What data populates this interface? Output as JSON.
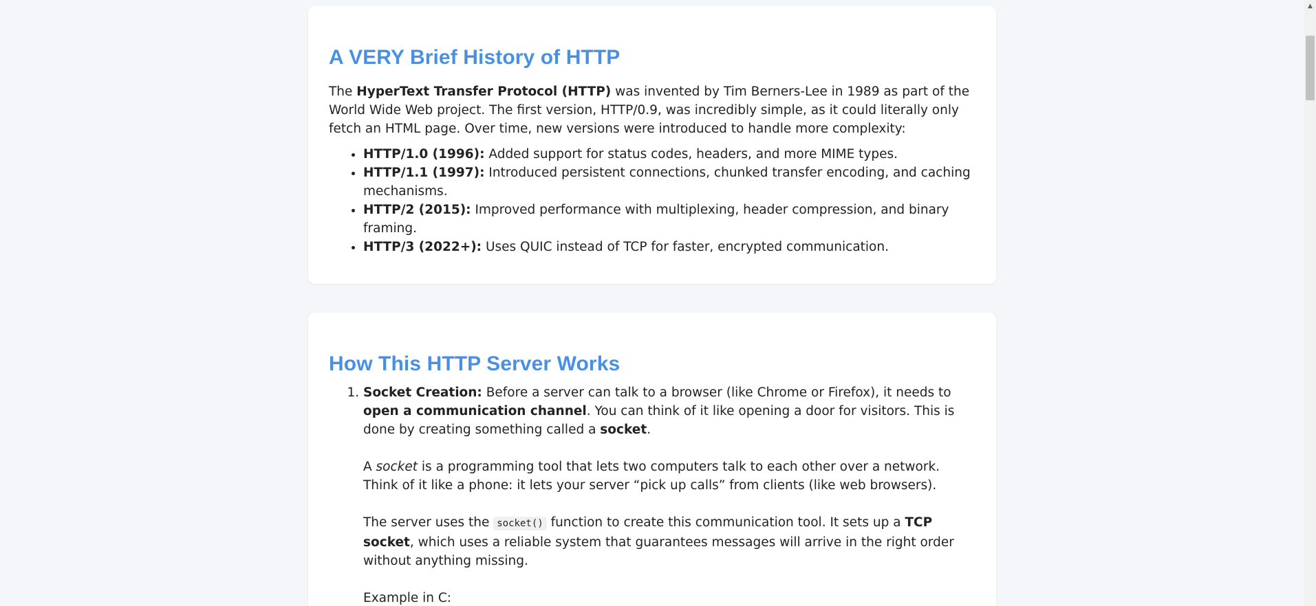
{
  "section1": {
    "title": "A VERY Brief History of HTTP",
    "intro_prefix": "The ",
    "intro_bold": "HyperText Transfer Protocol (HTTP)",
    "intro_suffix": " was invented by Tim Berners-Lee in 1989 as part of the World Wide Web project. The first version, HTTP/0.9, was incredibly simple, as it could literally only fetch an HTML page. Over time, new versions were introduced to handle more complexity:",
    "versions": [
      {
        "label": "HTTP/1.0 (1996):",
        "text": " Added support for status codes, headers, and more MIME types."
      },
      {
        "label": "HTTP/1.1 (1997):",
        "text": " Introduced persistent connections, chunked transfer encoding, and caching mechanisms."
      },
      {
        "label": "HTTP/2 (2015):",
        "text": " Improved performance with multiplexing, header compression, and binary framing."
      },
      {
        "label": "HTTP/3 (2022+):",
        "text": " Uses QUIC instead of TCP for faster, encrypted communication."
      }
    ]
  },
  "section2": {
    "title": "How This HTTP Server Works",
    "step1": {
      "label": "Socket Creation:",
      "p1_a": " Before a server can talk to a browser (like Chrome or Firefox), it needs to ",
      "p1_b": "open a communication channel",
      "p1_c": ". You can think of it like opening a door for visitors. This is done by creating something called a ",
      "p1_d": "socket",
      "p1_e": ".",
      "p2_a": "A ",
      "p2_b": "socket",
      "p2_c": " is a programming tool that lets two computers talk to each other over a network. Think of it like a phone: it lets your server “pick up calls” from clients (like web browsers).",
      "p3_a": "The server uses the ",
      "p3_code": "socket()",
      "p3_b": " function to create this communication tool. It sets up a ",
      "p3_bold": "TCP socket",
      "p3_c": ", which uses a reliable system that guarantees messages will arrive in the right order without anything missing.",
      "p4": "Example in C:"
    }
  },
  "colors": {
    "heading": "#4a90e2",
    "background": "#f5f6f9",
    "card": "#ffffff"
  }
}
